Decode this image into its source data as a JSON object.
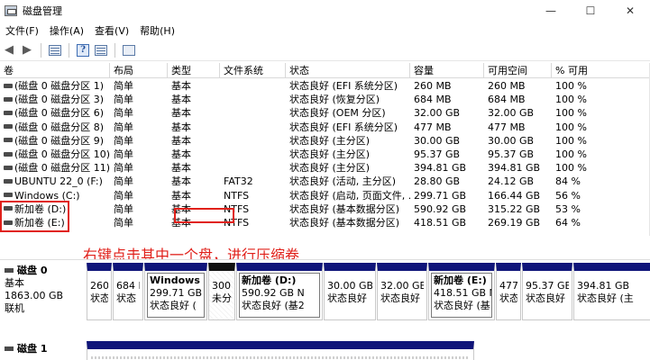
{
  "window": {
    "title": "磁盘管理",
    "controls": {
      "minimize": "—",
      "maximize": "☐",
      "close": "✕"
    }
  },
  "menu": [
    "文件(F)",
    "操作(A)",
    "查看(V)",
    "帮助(H)"
  ],
  "toolbar": {
    "icons": [
      "back-arrow-icon",
      "forward-arrow-icon",
      "properties-icon",
      "help-icon",
      "disk-view-icon",
      "settings-icon"
    ]
  },
  "columns": [
    "卷",
    "布局",
    "类型",
    "文件系统",
    "状态",
    "容量",
    "可用空间",
    "% 可用"
  ],
  "volumes": [
    {
      "name": "(磁盘 0 磁盘分区 1)",
      "layout": "简单",
      "type": "基本",
      "fs": "",
      "status": "状态良好 (EFI 系统分区)",
      "capacity": "260 MB",
      "free": "260 MB",
      "pct": "100 %"
    },
    {
      "name": "(磁盘 0 磁盘分区 3)",
      "layout": "简单",
      "type": "基本",
      "fs": "",
      "status": "状态良好 (恢复分区)",
      "capacity": "684 MB",
      "free": "684 MB",
      "pct": "100 %"
    },
    {
      "name": "(磁盘 0 磁盘分区 6)",
      "layout": "简单",
      "type": "基本",
      "fs": "",
      "status": "状态良好 (OEM 分区)",
      "capacity": "32.00 GB",
      "free": "32.00 GB",
      "pct": "100 %"
    },
    {
      "name": "(磁盘 0 磁盘分区 8)",
      "layout": "简单",
      "type": "基本",
      "fs": "",
      "status": "状态良好 (EFI 系统分区)",
      "capacity": "477 MB",
      "free": "477 MB",
      "pct": "100 %"
    },
    {
      "name": "(磁盘 0 磁盘分区 9)",
      "layout": "简单",
      "type": "基本",
      "fs": "",
      "status": "状态良好 (主分区)",
      "capacity": "30.00 GB",
      "free": "30.00 GB",
      "pct": "100 %"
    },
    {
      "name": "(磁盘 0 磁盘分区 10)",
      "layout": "简单",
      "type": "基本",
      "fs": "",
      "status": "状态良好 (主分区)",
      "capacity": "95.37 GB",
      "free": "95.37 GB",
      "pct": "100 %"
    },
    {
      "name": "(磁盘 0 磁盘分区 11)",
      "layout": "简单",
      "type": "基本",
      "fs": "",
      "status": "状态良好 (主分区)",
      "capacity": "394.81 GB",
      "free": "394.81 GB",
      "pct": "100 %"
    },
    {
      "name": "UBUNTU 22_0 (F:)",
      "layout": "简单",
      "type": "基本",
      "fs": "FAT32",
      "status": "状态良好 (活动, 主分区)",
      "capacity": "28.80 GB",
      "free": "24.12 GB",
      "pct": "84 %"
    },
    {
      "name": "Windows (C:)",
      "layout": "简单",
      "type": "基本",
      "fs": "NTFS",
      "status": "状态良好 (启动, 页面文件, ...",
      "capacity": "299.71 GB",
      "free": "166.44 GB",
      "pct": "56 %"
    },
    {
      "name": "新加卷 (D:)",
      "layout": "简单",
      "type": "基本",
      "fs": "NTFS",
      "status": "状态良好 (基本数据分区)",
      "capacity": "590.92 GB",
      "free": "315.22 GB",
      "pct": "53 %"
    },
    {
      "name": "新加卷 (E:)",
      "layout": "简单",
      "type": "基本",
      "fs": "NTFS",
      "status": "状态良好 (基本数据分区)",
      "capacity": "418.51 GB",
      "free": "269.19 GB",
      "pct": "64 %"
    }
  ],
  "annotation": "右键点击其中一个盘，进行压缩卷",
  "annotation_color": "#e0201a",
  "disk0": {
    "name": "磁盘 0",
    "kind": "基本",
    "size": "1863.00 GB",
    "state": "联机",
    "partitions": [
      {
        "title": "",
        "size": "260",
        "status": "状态"
      },
      {
        "title": "",
        "size": "684 I",
        "status": "状态"
      },
      {
        "title": "Windows（",
        "size": "299.71 GB N",
        "status": "状态良好 ("
      },
      {
        "title": "",
        "size": "300",
        "status": "未分"
      },
      {
        "title": "新加卷 (D:)",
        "size": "590.92 GB N",
        "status": "状态良好 (基2"
      },
      {
        "title": "",
        "size": "30.00 GB",
        "status": "状态良好"
      },
      {
        "title": "",
        "size": "32.00 GB",
        "status": "状态良好 ("
      },
      {
        "title": "新加卷 (E:)",
        "size": "418.51 GB N",
        "status": "状态良好 (基"
      },
      {
        "title": "",
        "size": "477",
        "status": "状态"
      },
      {
        "title": "",
        "size": "95.37 GB",
        "status": "状态良好"
      },
      {
        "title": "",
        "size": "394.81 GB",
        "status": "状态良好 (主"
      }
    ]
  },
  "disk1": {
    "name": "磁盘 1"
  },
  "colors": {
    "partition_bar": "#10157a",
    "unallocated_bar": "#111111",
    "highlight": "#e0201a"
  }
}
